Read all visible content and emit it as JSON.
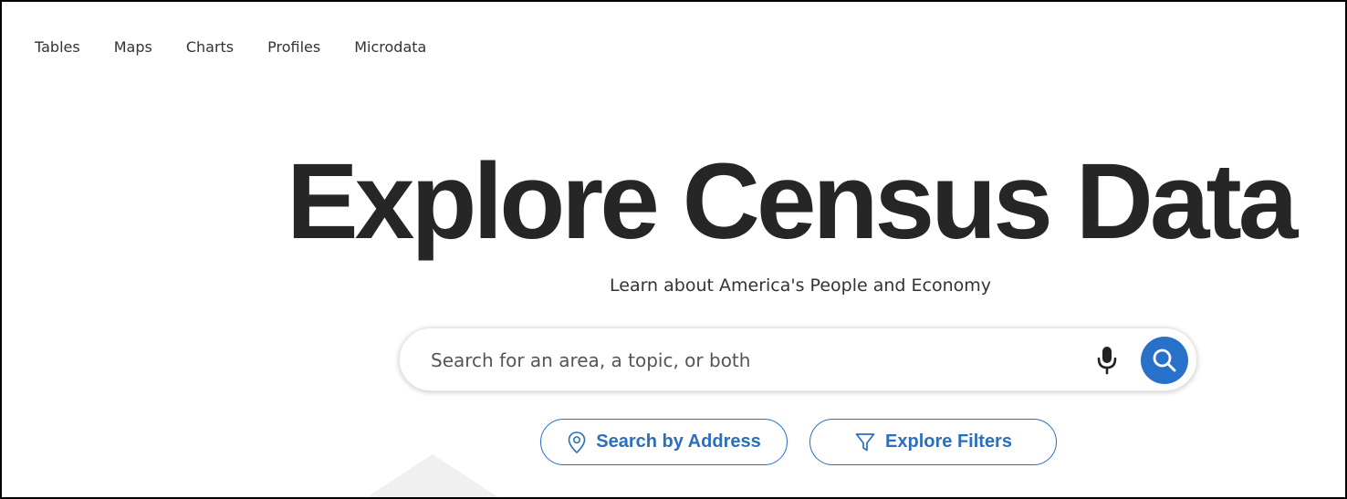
{
  "nav": {
    "items": [
      {
        "label": "Tables"
      },
      {
        "label": "Maps"
      },
      {
        "label": "Charts"
      },
      {
        "label": "Profiles"
      },
      {
        "label": "Microdata"
      }
    ]
  },
  "hero": {
    "title": "Explore Census Data",
    "subtitle": "Learn about America's People and Economy"
  },
  "search": {
    "placeholder": "Search for an area, a topic, or both",
    "value": "",
    "mic_icon": "microphone-icon",
    "submit_icon": "search-icon"
  },
  "actions": {
    "address_label": "Search by Address",
    "address_icon": "location-pin-icon",
    "filters_label": "Explore Filters",
    "filters_icon": "filter-icon"
  },
  "colors": {
    "accent": "#2771c9",
    "pill_text": "#2a6fbe",
    "title": "#262626",
    "text": "#333333"
  }
}
